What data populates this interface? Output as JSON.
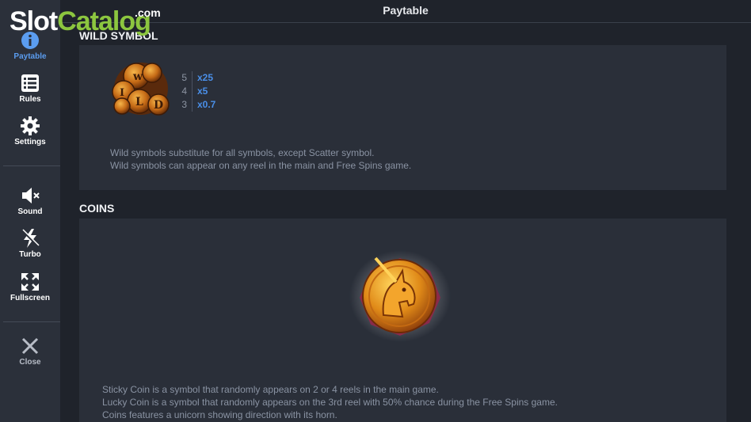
{
  "watermark": {
    "part1": "Slot",
    "part2": "Catalog",
    "suffix": ".com"
  },
  "sidebar": {
    "items": [
      {
        "label": "Paytable",
        "icon": "info-icon"
      },
      {
        "label": "Rules",
        "icon": "list-icon"
      },
      {
        "label": "Settings",
        "icon": "gear-icon"
      },
      {
        "label": "Sound",
        "icon": "speaker-muted-icon"
      },
      {
        "label": "Turbo",
        "icon": "lightning-icon"
      },
      {
        "label": "Fullscreen",
        "icon": "fullscreen-icon"
      },
      {
        "label": "Close",
        "icon": "close-icon"
      }
    ]
  },
  "header": {
    "title": "Paytable"
  },
  "wild_section": {
    "title": "WILD SYMBOL",
    "payouts": [
      {
        "count": "5",
        "multiplier": "x25"
      },
      {
        "count": "4",
        "multiplier": "x5"
      },
      {
        "count": "3",
        "multiplier": "x0.7"
      }
    ],
    "description": [
      "Wild symbols substitute for all symbols, except Scatter symbol.",
      "Wild symbols can appear on any reel in the main and Free Spins game."
    ]
  },
  "coins_section": {
    "title": "COINS",
    "description": [
      "Sticky Coin is a symbol that randomly appears on 2 or 4 reels in the main game.",
      "Lucky Coin is  a symbol that randomly appears on the 3rd reel with 50% chance during the Free Spins game.",
      "Coins features a unicorn showing direction with its horn."
    ]
  },
  "colors": {
    "accent": "#5b9df0",
    "multiplier": "#4a8fe8",
    "panel": "#2a2f39",
    "background": "#1f232b"
  }
}
